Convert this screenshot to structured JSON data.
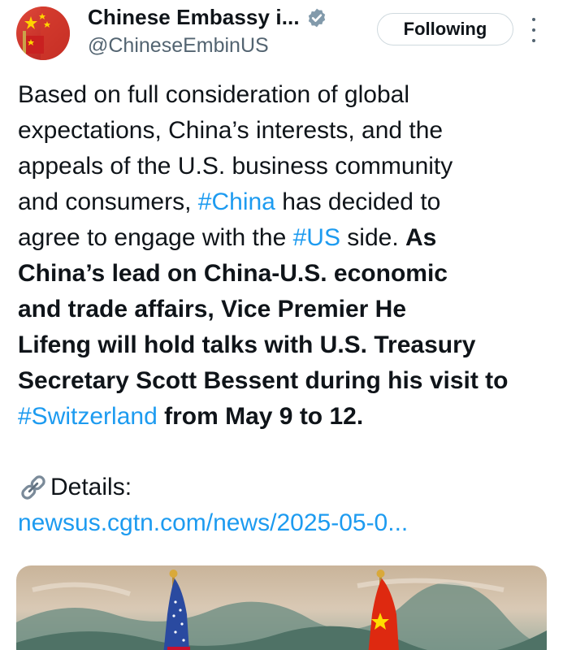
{
  "account": {
    "display_name": "Chinese Embassy i...",
    "handle": "@ChineseEmbinUS",
    "verified_icon": "verified-badge-icon",
    "avatar_icon": "flag-avatar-icon"
  },
  "follow_button": {
    "label": "Following"
  },
  "more_menu": {
    "icon": "more-vertical-icon"
  },
  "tweet": {
    "lines": [
      [
        {
          "text": "Based on full consideration of global"
        }
      ],
      [
        {
          "text": "expectations, China’s interests, and the"
        }
      ],
      [
        {
          "text": "appeals of the U.S. business community"
        }
      ],
      [
        {
          "text": "and consumers, "
        },
        {
          "text": "#China",
          "hashtag": true
        },
        {
          "text": " has decided to"
        }
      ],
      [
        {
          "text": "agree to engage with the "
        },
        {
          "text": "#US",
          "hashtag": true
        },
        {
          "text": " side. "
        },
        {
          "text": "As",
          "bold": true
        }
      ],
      [
        {
          "text": "China’s lead on China-U.S. economic",
          "bold": true
        }
      ],
      [
        {
          "text": "and trade affairs, Vice Premier He",
          "bold": true
        }
      ],
      [
        {
          "text": "Lifeng will hold talks with U.S. Treasury",
          "bold": true
        }
      ],
      [
        {
          "text": "Secretary Scott Bessent during his visit to",
          "bold": true
        }
      ],
      [
        {
          "text": "#Switzerland",
          "hashtag": true
        },
        {
          "text": " from May 9 to 12.",
          "bold": true
        }
      ]
    ],
    "details_label": "Details:",
    "details_icon": "link-icon",
    "link_text": "newsus.cgtn.com/news/2025-05-0..."
  },
  "media": {
    "description_icon": "flags-photo"
  },
  "colors": {
    "accent": "#1d9bf0",
    "text": "#0f1419",
    "secondary": "#536471",
    "verified_badge": "#829aab"
  }
}
